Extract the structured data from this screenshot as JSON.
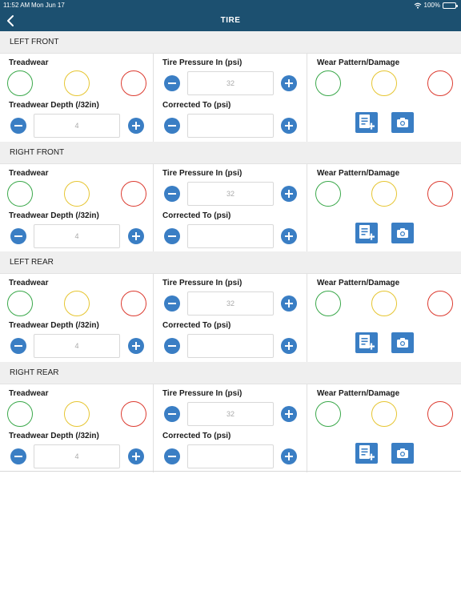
{
  "status": {
    "time": "11:52 AM",
    "date": "Mon Jun 17",
    "battery": "100%"
  },
  "nav": {
    "title": "TIRE"
  },
  "labels": {
    "treadwear": "Treadwear",
    "treadwear_depth": "Treadwear Depth (/32in)",
    "pressure_in": "Tire Pressure In (psi)",
    "corrected_to": "Corrected To (psi)",
    "wear_pattern": "Wear Pattern/Damage"
  },
  "sections": [
    {
      "title": "LEFT FRONT",
      "treadwear_depth_placeholder": "4",
      "pressure_placeholder": "32",
      "corrected_value": ""
    },
    {
      "title": "RIGHT FRONT",
      "treadwear_depth_placeholder": "4",
      "pressure_placeholder": "32",
      "corrected_value": ""
    },
    {
      "title": "LEFT REAR",
      "treadwear_depth_placeholder": "4",
      "pressure_placeholder": "32",
      "corrected_value": ""
    },
    {
      "title": "RIGHT REAR",
      "treadwear_depth_placeholder": "4",
      "pressure_placeholder": "32",
      "corrected_value": ""
    }
  ],
  "colors": {
    "header": "#1c5070",
    "accent": "#3a7ec4",
    "good": "#3aa84a",
    "caution": "#e6c531",
    "bad": "#dc3b30"
  },
  "icons": {
    "back": "chevron-left-icon",
    "add_note": "add-document-icon",
    "camera": "camera-icon",
    "minus": "minus-icon",
    "plus": "plus-icon"
  }
}
